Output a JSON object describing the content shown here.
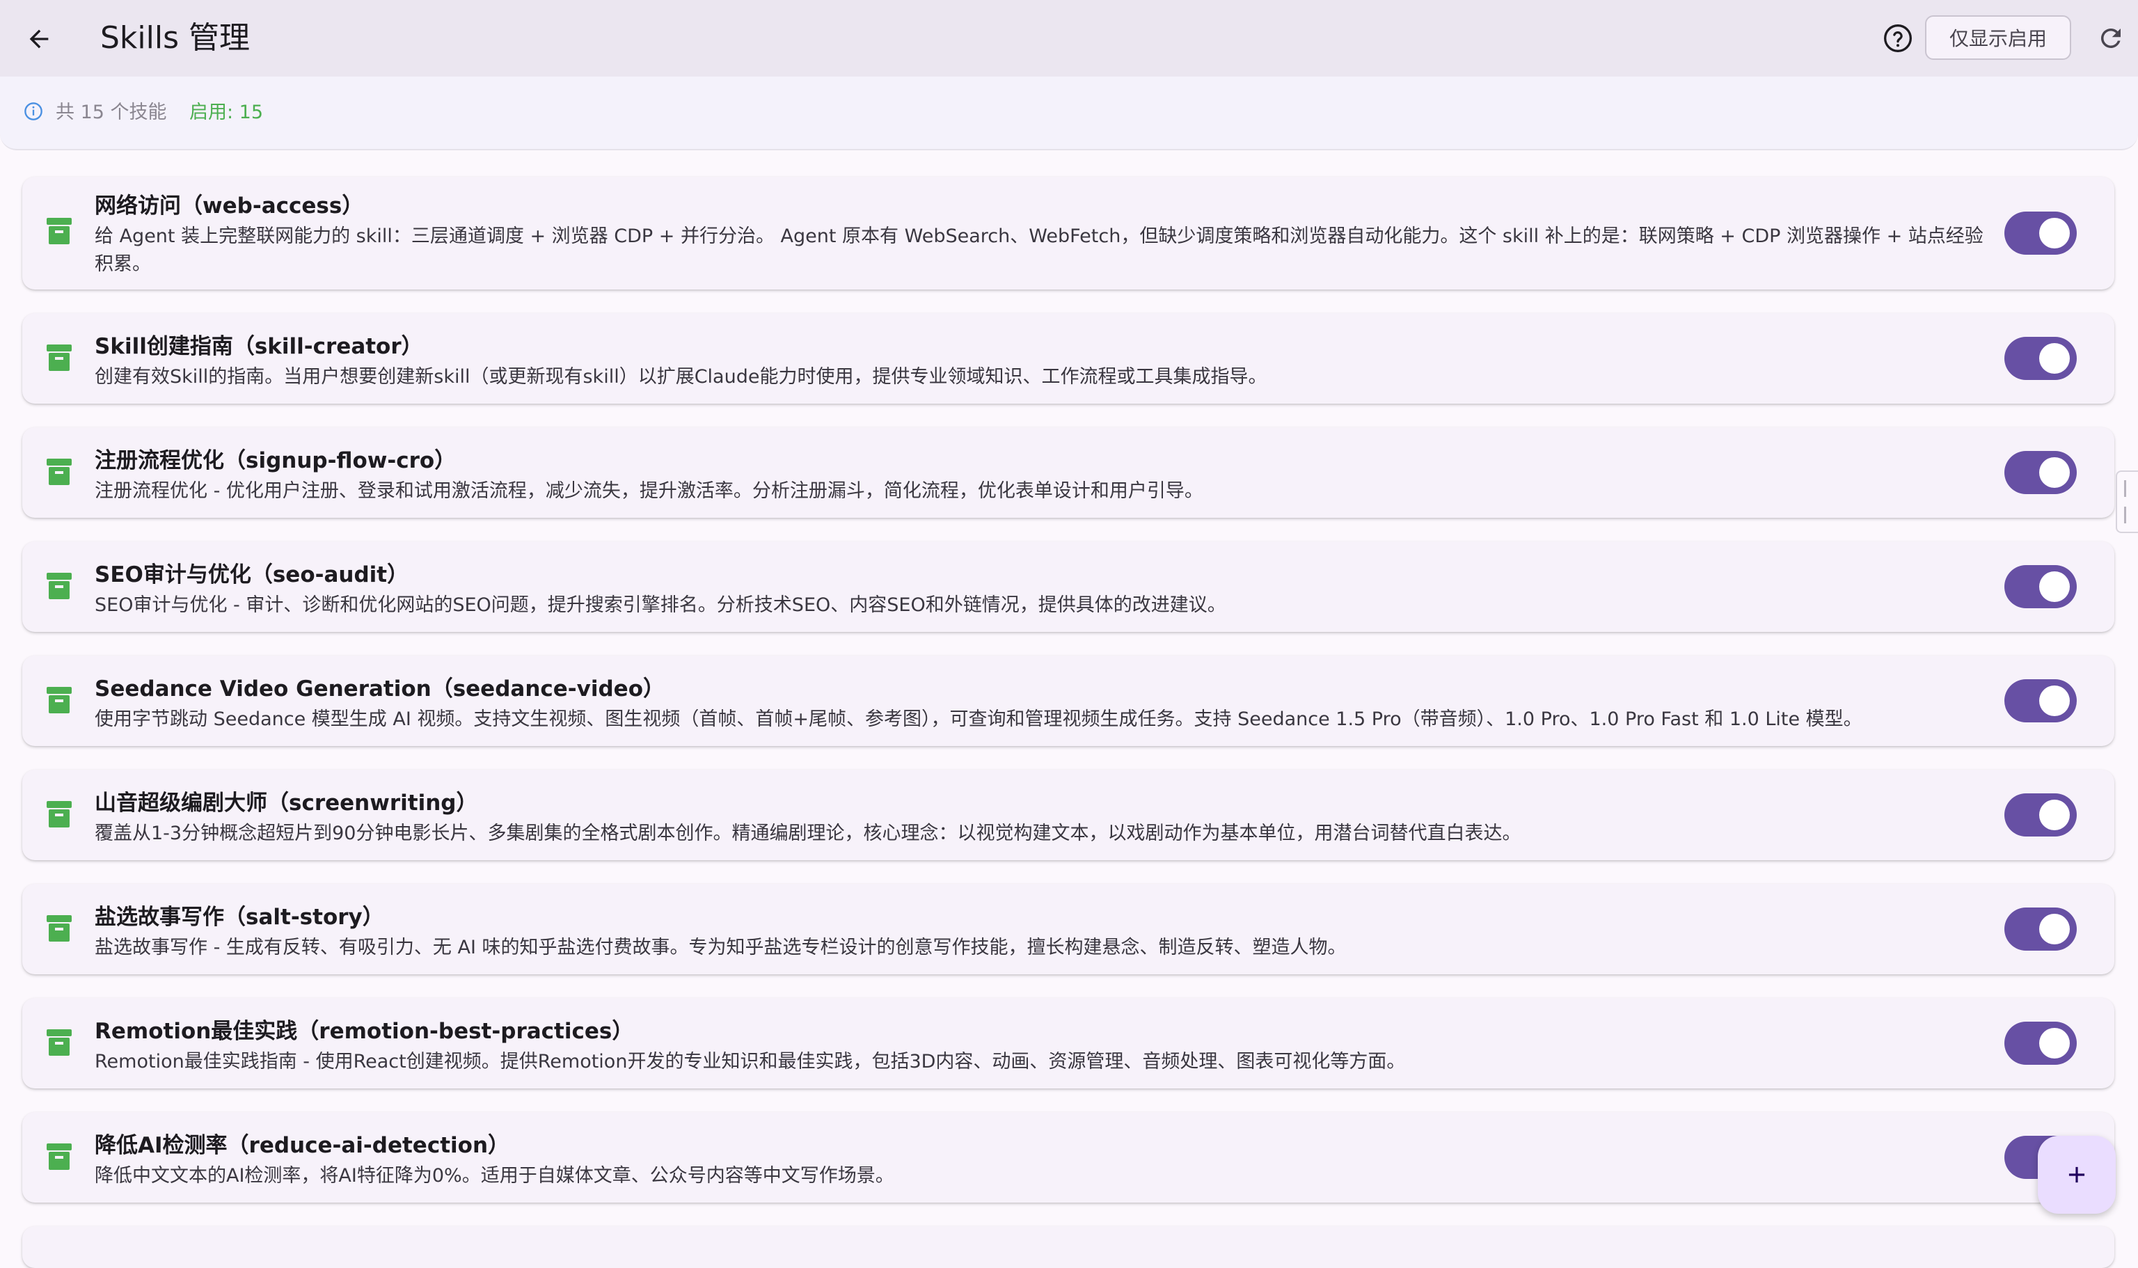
{
  "header": {
    "title": "Skills 管理",
    "filter_label": "仅显示启用"
  },
  "summary": {
    "count_text": "共 15 个技能",
    "enabled_text": "启用: 15"
  },
  "colors": {
    "accent": "#6750a4",
    "skill_icon": "#4caf50",
    "enabled_text": "#4caf50"
  },
  "skills": [
    {
      "title": "网络访问（web-access）",
      "description": "给 Agent 装上完整联网能力的 skill：三层通道调度 + 浏览器 CDP + 并行分治。 Agent 原本有 WebSearch、WebFetch，但缺少调度策略和浏览器自动化能力。这个 skill 补上的是：联网策略 + CDP 浏览器操作 + 站点经验积累。",
      "enabled": true
    },
    {
      "title": "Skill创建指南（skill-creator）",
      "description": "创建有效Skill的指南。当用户想要创建新skill（或更新现有skill）以扩展Claude能力时使用，提供专业领域知识、工作流程或工具集成指导。",
      "enabled": true
    },
    {
      "title": "注册流程优化（signup-flow-cro）",
      "description": "注册流程优化 - 优化用户注册、登录和试用激活流程，减少流失，提升激活率。分析注册漏斗，简化流程，优化表单设计和用户引导。",
      "enabled": true
    },
    {
      "title": "SEO审计与优化（seo-audit）",
      "description": "SEO审计与优化 - 审计、诊断和优化网站的SEO问题，提升搜索引擎排名。分析技术SEO、内容SEO和外链情况，提供具体的改进建议。",
      "enabled": true
    },
    {
      "title": "Seedance Video Generation（seedance-video）",
      "description": "使用字节跳动 Seedance 模型生成 AI 视频。支持文生视频、图生视频（首帧、首帧+尾帧、参考图），可查询和管理视频生成任务。支持 Seedance 1.5 Pro（带音频）、1.0 Pro、1.0 Pro Fast 和 1.0 Lite 模型。",
      "enabled": true
    },
    {
      "title": "山音超级编剧大师（screenwriting）",
      "description": "覆盖从1-3分钟概念超短片到90分钟电影长片、多集剧集的全格式剧本创作。精通编剧理论，核心理念：以视觉构建文本，以戏剧动作为基本单位，用潜台词替代直白表达。",
      "enabled": true
    },
    {
      "title": "盐选故事写作（salt-story）",
      "description": "盐选故事写作 - 生成有反转、有吸引力、无 AI 味的知乎盐选付费故事。专为知乎盐选专栏设计的创意写作技能，擅长构建悬念、制造反转、塑造人物。",
      "enabled": true
    },
    {
      "title": "Remotion最佳实践（remotion-best-practices）",
      "description": "Remotion最佳实践指南 - 使用React创建视频。提供Remotion开发的专业知识和最佳实践，包括3D内容、动画、资源管理、音频处理、图表可视化等方面。",
      "enabled": true
    },
    {
      "title": "降低AI检测率（reduce-ai-detection）",
      "description": "降低中文文本的AI检测率，将AI特征降为0%。适用于自媒体文章、公众号内容等中文写作场景。",
      "enabled": true
    }
  ]
}
